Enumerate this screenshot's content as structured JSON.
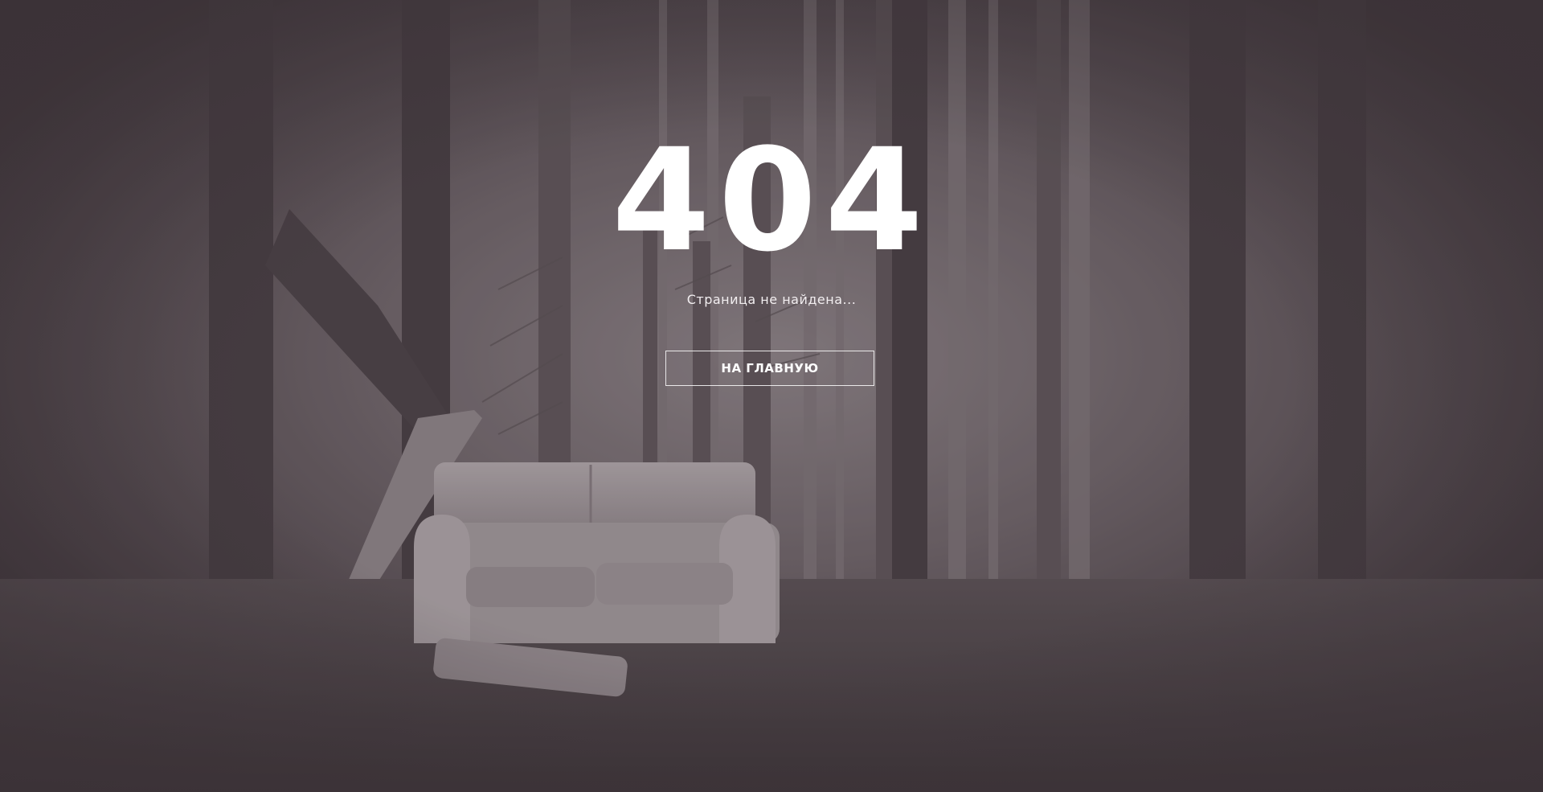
{
  "error": {
    "code": "404",
    "message": "Страница не найдена..."
  },
  "actions": {
    "home_label": "НА ГЛАВНУЮ"
  },
  "colors": {
    "text": "#ffffff",
    "overlay": "#3f363b"
  }
}
